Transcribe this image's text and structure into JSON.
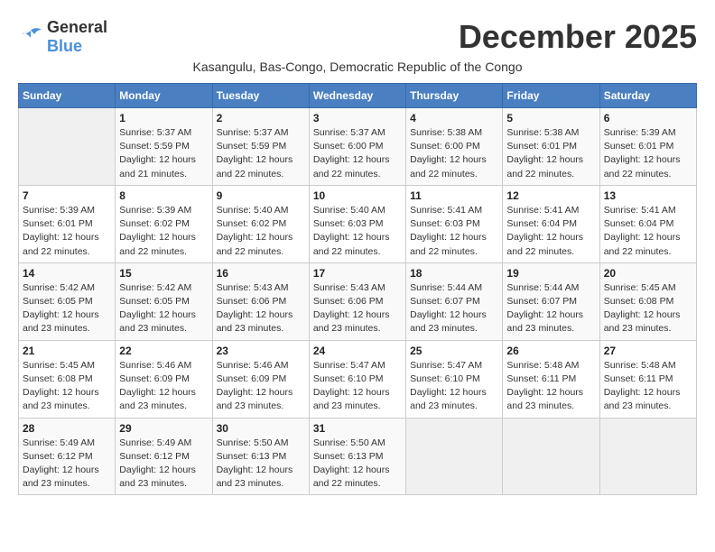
{
  "logo": {
    "general": "General",
    "blue": "Blue"
  },
  "title": "December 2025",
  "subtitle": "Kasangulu, Bas-Congo, Democratic Republic of the Congo",
  "days_of_week": [
    "Sunday",
    "Monday",
    "Tuesday",
    "Wednesday",
    "Thursday",
    "Friday",
    "Saturday"
  ],
  "weeks": [
    [
      {
        "day": "",
        "info": ""
      },
      {
        "day": "1",
        "info": "Sunrise: 5:37 AM\nSunset: 5:59 PM\nDaylight: 12 hours\nand 21 minutes."
      },
      {
        "day": "2",
        "info": "Sunrise: 5:37 AM\nSunset: 5:59 PM\nDaylight: 12 hours\nand 22 minutes."
      },
      {
        "day": "3",
        "info": "Sunrise: 5:37 AM\nSunset: 6:00 PM\nDaylight: 12 hours\nand 22 minutes."
      },
      {
        "day": "4",
        "info": "Sunrise: 5:38 AM\nSunset: 6:00 PM\nDaylight: 12 hours\nand 22 minutes."
      },
      {
        "day": "5",
        "info": "Sunrise: 5:38 AM\nSunset: 6:01 PM\nDaylight: 12 hours\nand 22 minutes."
      },
      {
        "day": "6",
        "info": "Sunrise: 5:39 AM\nSunset: 6:01 PM\nDaylight: 12 hours\nand 22 minutes."
      }
    ],
    [
      {
        "day": "7",
        "info": "Sunrise: 5:39 AM\nSunset: 6:01 PM\nDaylight: 12 hours\nand 22 minutes."
      },
      {
        "day": "8",
        "info": "Sunrise: 5:39 AM\nSunset: 6:02 PM\nDaylight: 12 hours\nand 22 minutes."
      },
      {
        "day": "9",
        "info": "Sunrise: 5:40 AM\nSunset: 6:02 PM\nDaylight: 12 hours\nand 22 minutes."
      },
      {
        "day": "10",
        "info": "Sunrise: 5:40 AM\nSunset: 6:03 PM\nDaylight: 12 hours\nand 22 minutes."
      },
      {
        "day": "11",
        "info": "Sunrise: 5:41 AM\nSunset: 6:03 PM\nDaylight: 12 hours\nand 22 minutes."
      },
      {
        "day": "12",
        "info": "Sunrise: 5:41 AM\nSunset: 6:04 PM\nDaylight: 12 hours\nand 22 minutes."
      },
      {
        "day": "13",
        "info": "Sunrise: 5:41 AM\nSunset: 6:04 PM\nDaylight: 12 hours\nand 22 minutes."
      }
    ],
    [
      {
        "day": "14",
        "info": "Sunrise: 5:42 AM\nSunset: 6:05 PM\nDaylight: 12 hours\nand 23 minutes."
      },
      {
        "day": "15",
        "info": "Sunrise: 5:42 AM\nSunset: 6:05 PM\nDaylight: 12 hours\nand 23 minutes."
      },
      {
        "day": "16",
        "info": "Sunrise: 5:43 AM\nSunset: 6:06 PM\nDaylight: 12 hours\nand 23 minutes."
      },
      {
        "day": "17",
        "info": "Sunrise: 5:43 AM\nSunset: 6:06 PM\nDaylight: 12 hours\nand 23 minutes."
      },
      {
        "day": "18",
        "info": "Sunrise: 5:44 AM\nSunset: 6:07 PM\nDaylight: 12 hours\nand 23 minutes."
      },
      {
        "day": "19",
        "info": "Sunrise: 5:44 AM\nSunset: 6:07 PM\nDaylight: 12 hours\nand 23 minutes."
      },
      {
        "day": "20",
        "info": "Sunrise: 5:45 AM\nSunset: 6:08 PM\nDaylight: 12 hours\nand 23 minutes."
      }
    ],
    [
      {
        "day": "21",
        "info": "Sunrise: 5:45 AM\nSunset: 6:08 PM\nDaylight: 12 hours\nand 23 minutes."
      },
      {
        "day": "22",
        "info": "Sunrise: 5:46 AM\nSunset: 6:09 PM\nDaylight: 12 hours\nand 23 minutes."
      },
      {
        "day": "23",
        "info": "Sunrise: 5:46 AM\nSunset: 6:09 PM\nDaylight: 12 hours\nand 23 minutes."
      },
      {
        "day": "24",
        "info": "Sunrise: 5:47 AM\nSunset: 6:10 PM\nDaylight: 12 hours\nand 23 minutes."
      },
      {
        "day": "25",
        "info": "Sunrise: 5:47 AM\nSunset: 6:10 PM\nDaylight: 12 hours\nand 23 minutes."
      },
      {
        "day": "26",
        "info": "Sunrise: 5:48 AM\nSunset: 6:11 PM\nDaylight: 12 hours\nand 23 minutes."
      },
      {
        "day": "27",
        "info": "Sunrise: 5:48 AM\nSunset: 6:11 PM\nDaylight: 12 hours\nand 23 minutes."
      }
    ],
    [
      {
        "day": "28",
        "info": "Sunrise: 5:49 AM\nSunset: 6:12 PM\nDaylight: 12 hours\nand 23 minutes."
      },
      {
        "day": "29",
        "info": "Sunrise: 5:49 AM\nSunset: 6:12 PM\nDaylight: 12 hours\nand 23 minutes."
      },
      {
        "day": "30",
        "info": "Sunrise: 5:50 AM\nSunset: 6:13 PM\nDaylight: 12 hours\nand 23 minutes."
      },
      {
        "day": "31",
        "info": "Sunrise: 5:50 AM\nSunset: 6:13 PM\nDaylight: 12 hours\nand 22 minutes."
      },
      {
        "day": "",
        "info": ""
      },
      {
        "day": "",
        "info": ""
      },
      {
        "day": "",
        "info": ""
      }
    ]
  ]
}
